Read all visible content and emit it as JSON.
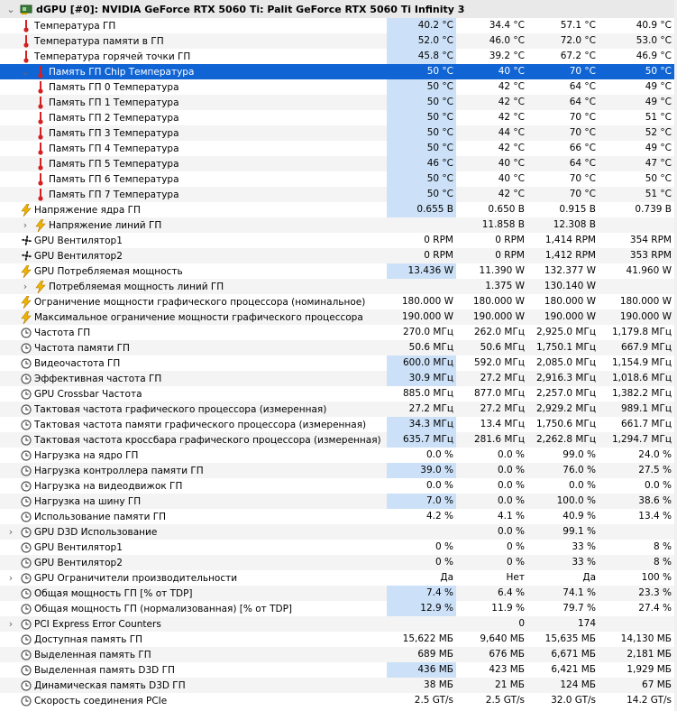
{
  "colors": {
    "selection": "#1064d4",
    "highlight": "#cce1f7",
    "alt_row": "#f4f4f4",
    "header": "#e9e9e9",
    "temp_icon": "#d42020",
    "bolt_icon": "#f0b400"
  },
  "header": {
    "title": "dGPU [#0]: NVIDIA GeForce RTX 5060 Ti: Palit GeForce RTX 5060 Ti Infinity 3",
    "icon": "gpu-card-icon"
  },
  "rows": [
    {
      "indent": 0,
      "exp": "",
      "icon": "temp",
      "label": "Температура ГП",
      "v": [
        "40.2 °C",
        "34.4 °C",
        "57.1 °C",
        "40.9 °C"
      ],
      "hl": true
    },
    {
      "indent": 0,
      "exp": "",
      "icon": "temp",
      "label": "Температура памяти в ГП",
      "v": [
        "52.0 °C",
        "46.0 °C",
        "72.0 °C",
        "53.0 °C"
      ],
      "hl": true
    },
    {
      "indent": 0,
      "exp": "",
      "icon": "temp",
      "label": "Температура горячей точки ГП",
      "v": [
        "45.8 °C",
        "39.2 °C",
        "67.2 °C",
        "46.9 °C"
      ],
      "hl": true
    },
    {
      "indent": 1,
      "exp": "v",
      "icon": "temp",
      "label": "Память ГП Chip Температура",
      "v": [
        "50 °C",
        "40 °C",
        "70 °C",
        "50 °C"
      ],
      "hl": true,
      "sel": true
    },
    {
      "indent": 1,
      "exp": "",
      "icon": "temp",
      "label": "Память ГП 0 Температура",
      "v": [
        "50 °C",
        "42 °C",
        "64 °C",
        "49 °C"
      ],
      "hl": true
    },
    {
      "indent": 1,
      "exp": "",
      "icon": "temp",
      "label": "Память ГП 1 Температура",
      "v": [
        "50 °C",
        "42 °C",
        "64 °C",
        "49 °C"
      ],
      "hl": true
    },
    {
      "indent": 1,
      "exp": "",
      "icon": "temp",
      "label": "Память ГП 2 Температура",
      "v": [
        "50 °C",
        "42 °C",
        "70 °C",
        "51 °C"
      ],
      "hl": true
    },
    {
      "indent": 1,
      "exp": "",
      "icon": "temp",
      "label": "Память ГП 3 Температура",
      "v": [
        "50 °C",
        "44 °C",
        "70 °C",
        "52 °C"
      ],
      "hl": true
    },
    {
      "indent": 1,
      "exp": "",
      "icon": "temp",
      "label": "Память ГП 4 Температура",
      "v": [
        "50 °C",
        "42 °C",
        "66 °C",
        "49 °C"
      ],
      "hl": true
    },
    {
      "indent": 1,
      "exp": "",
      "icon": "temp",
      "label": "Память ГП 5 Температура",
      "v": [
        "46 °C",
        "40 °C",
        "64 °C",
        "47 °C"
      ],
      "hl": true
    },
    {
      "indent": 1,
      "exp": "",
      "icon": "temp",
      "label": "Память ГП 6 Температура",
      "v": [
        "50 °C",
        "40 °C",
        "70 °C",
        "50 °C"
      ],
      "hl": true
    },
    {
      "indent": 1,
      "exp": "",
      "icon": "temp",
      "label": "Память ГП 7 Температура",
      "v": [
        "50 °C",
        "42 °C",
        "70 °C",
        "51 °C"
      ],
      "hl": true
    },
    {
      "indent": 0,
      "exp": "",
      "icon": "bolt",
      "label": "Напряжение ядра ГП",
      "v": [
        "0.655 В",
        "0.650 В",
        "0.915 В",
        "0.739 В"
      ],
      "hl": true
    },
    {
      "indent": 1,
      "exp": ">",
      "icon": "bolt",
      "label": "Напряжение линий ГП",
      "v": [
        "",
        "11.858 В",
        "12.308 В",
        ""
      ],
      "hl": false
    },
    {
      "indent": 0,
      "exp": "",
      "icon": "fan",
      "label": "GPU Вентилятор1",
      "v": [
        "0 RPM",
        "0 RPM",
        "1,414 RPM",
        "354 RPM"
      ],
      "hl": false
    },
    {
      "indent": 0,
      "exp": "",
      "icon": "fan",
      "label": "GPU Вентилятор2",
      "v": [
        "0 RPM",
        "0 RPM",
        "1,412 RPM",
        "353 RPM"
      ],
      "hl": false
    },
    {
      "indent": 0,
      "exp": "",
      "icon": "bolt",
      "label": "GPU Потребляемая мощность",
      "v": [
        "13.436 W",
        "11.390 W",
        "132.377 W",
        "41.960 W"
      ],
      "hl": true
    },
    {
      "indent": 1,
      "exp": ">",
      "icon": "bolt",
      "label": "Потребляемая мощность линий ГП",
      "v": [
        "",
        "1.375 W",
        "130.140 W",
        ""
      ],
      "hl": false
    },
    {
      "indent": 0,
      "exp": "",
      "icon": "bolt",
      "label": "Ограничение мощности графического процессора (номинальное)",
      "v": [
        "180.000 W",
        "180.000 W",
        "180.000 W",
        "180.000 W"
      ],
      "hl": false
    },
    {
      "indent": 0,
      "exp": "",
      "icon": "bolt",
      "label": "Максимальное ограничение мощности графического процессора",
      "v": [
        "190.000 W",
        "190.000 W",
        "190.000 W",
        "190.000 W"
      ],
      "hl": false
    },
    {
      "indent": 0,
      "exp": "",
      "icon": "clock",
      "label": "Частота ГП",
      "v": [
        "270.0 МГц",
        "262.0 МГц",
        "2,925.0 МГц",
        "1,179.8 МГц"
      ],
      "hl": false
    },
    {
      "indent": 0,
      "exp": "",
      "icon": "clock",
      "label": "Частота памяти ГП",
      "v": [
        "50.6 МГц",
        "50.6 МГц",
        "1,750.1 МГц",
        "667.9 МГц"
      ],
      "hl": false
    },
    {
      "indent": 0,
      "exp": "",
      "icon": "clock",
      "label": "Видеочастота ГП",
      "v": [
        "600.0 МГц",
        "592.0 МГц",
        "2,085.0 МГц",
        "1,154.9 МГц"
      ],
      "hl": true
    },
    {
      "indent": 0,
      "exp": "",
      "icon": "clock",
      "label": "Эффективная частота ГП",
      "v": [
        "30.9 МГц",
        "27.2 МГц",
        "2,916.3 МГц",
        "1,018.6 МГц"
      ],
      "hl": true
    },
    {
      "indent": 0,
      "exp": "",
      "icon": "clock",
      "label": "GPU Crossbar Частота",
      "v": [
        "885.0 МГц",
        "877.0 МГц",
        "2,257.0 МГц",
        "1,382.2 МГц"
      ],
      "hl": false
    },
    {
      "indent": 0,
      "exp": "",
      "icon": "clock",
      "label": "Тактовая частота графического процессора (измеренная)",
      "v": [
        "27.2 МГц",
        "27.2 МГц",
        "2,929.2 МГц",
        "989.1 МГц"
      ],
      "hl": false
    },
    {
      "indent": 0,
      "exp": "",
      "icon": "clock",
      "label": "Тактовая частота памяти графического процессора (измеренная)",
      "v": [
        "34.3 МГц",
        "13.4 МГц",
        "1,750.6 МГц",
        "661.7 МГц"
      ],
      "hl": true
    },
    {
      "indent": 0,
      "exp": "",
      "icon": "clock",
      "label": "Тактовая частота кроссбара графического процессора (измеренная)",
      "v": [
        "635.7 МГц",
        "281.6 МГц",
        "2,262.8 МГц",
        "1,294.7 МГц"
      ],
      "hl": true
    },
    {
      "indent": 0,
      "exp": "",
      "icon": "clock",
      "label": "Нагрузка на ядро ГП",
      "v": [
        "0.0 %",
        "0.0 %",
        "99.0 %",
        "24.0 %"
      ],
      "hl": false
    },
    {
      "indent": 0,
      "exp": "",
      "icon": "clock",
      "label": "Нагрузка контроллера памяти ГП",
      "v": [
        "39.0 %",
        "0.0 %",
        "76.0 %",
        "27.5 %"
      ],
      "hl": true
    },
    {
      "indent": 0,
      "exp": "",
      "icon": "clock",
      "label": "Нагрузка на видеодвижок ГП",
      "v": [
        "0.0 %",
        "0.0 %",
        "0.0 %",
        "0.0 %"
      ],
      "hl": false
    },
    {
      "indent": 0,
      "exp": "",
      "icon": "clock",
      "label": "Нагрузка на шину ГП",
      "v": [
        "7.0 %",
        "0.0 %",
        "100.0 %",
        "38.6 %"
      ],
      "hl": true
    },
    {
      "indent": 0,
      "exp": "",
      "icon": "clock",
      "label": "Использование памяти ГП",
      "v": [
        "4.2 %",
        "4.1 %",
        "40.9 %",
        "13.4 %"
      ],
      "hl": false
    },
    {
      "indent": 0,
      "exp": ">",
      "icon": "clock",
      "label": "GPU D3D Использование",
      "v": [
        "",
        "0.0 %",
        "99.1 %",
        ""
      ],
      "hl": false
    },
    {
      "indent": 0,
      "exp": "",
      "icon": "clock",
      "label": "GPU Вентилятор1",
      "v": [
        "0 %",
        "0 %",
        "33 %",
        "8 %"
      ],
      "hl": false
    },
    {
      "indent": 0,
      "exp": "",
      "icon": "clock",
      "label": "GPU Вентилятор2",
      "v": [
        "0 %",
        "0 %",
        "33 %",
        "8 %"
      ],
      "hl": false
    },
    {
      "indent": 0,
      "exp": ">",
      "icon": "clock",
      "label": "GPU Ограничители производительности",
      "v": [
        "Да",
        "Нет",
        "Да",
        "100 %"
      ],
      "hl": false
    },
    {
      "indent": 0,
      "exp": "",
      "icon": "clock",
      "label": "Общая мощность ГП [% от TDP]",
      "v": [
        "7.4 %",
        "6.4 %",
        "74.1 %",
        "23.3 %"
      ],
      "hl": true
    },
    {
      "indent": 0,
      "exp": "",
      "icon": "clock",
      "label": "Общая мощность ГП (нормализованная) [% от TDP]",
      "v": [
        "12.9 %",
        "11.9 %",
        "79.7 %",
        "27.4 %"
      ],
      "hl": true
    },
    {
      "indent": 0,
      "exp": ">",
      "icon": "clock",
      "label": "PCI Express Error Counters",
      "v": [
        "",
        "0",
        "174",
        ""
      ],
      "hl": false
    },
    {
      "indent": 0,
      "exp": "",
      "icon": "clock",
      "label": "Доступная память ГП",
      "v": [
        "15,622 МБ",
        "9,640 МБ",
        "15,635 МБ",
        "14,130 МБ"
      ],
      "hl": false
    },
    {
      "indent": 0,
      "exp": "",
      "icon": "clock",
      "label": "Выделенная память ГП",
      "v": [
        "689 МБ",
        "676 МБ",
        "6,671 МБ",
        "2,181 МБ"
      ],
      "hl": false
    },
    {
      "indent": 0,
      "exp": "",
      "icon": "clock",
      "label": "Выделенная память D3D ГП",
      "v": [
        "436 МБ",
        "423 МБ",
        "6,421 МБ",
        "1,929 МБ"
      ],
      "hl": true
    },
    {
      "indent": 0,
      "exp": "",
      "icon": "clock",
      "label": "Динамическая память D3D ГП",
      "v": [
        "38 МБ",
        "21 МБ",
        "124 МБ",
        "67 МБ"
      ],
      "hl": false
    },
    {
      "indent": 0,
      "exp": "",
      "icon": "clock",
      "label": "Скорость соединения PCIe",
      "v": [
        "2.5 GT/s",
        "2.5 GT/s",
        "32.0 GT/s",
        "14.2 GT/s"
      ],
      "hl": false
    }
  ]
}
